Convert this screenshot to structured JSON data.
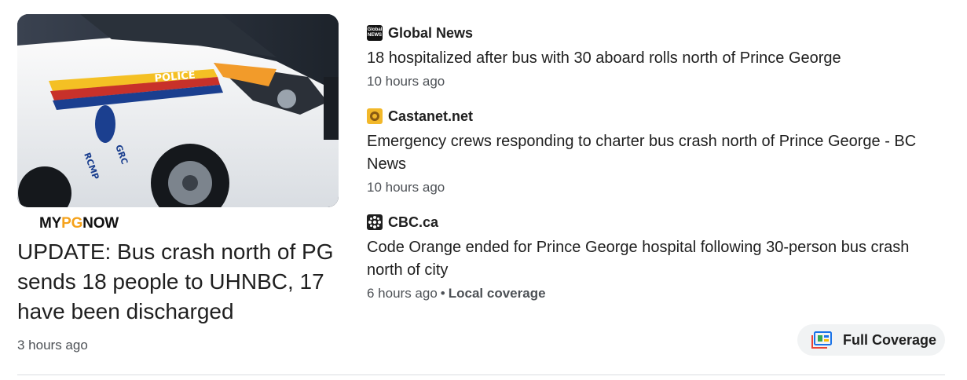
{
  "featured": {
    "source_logo_prefix": "MY",
    "source_logo_highlight": "PG",
    "source_logo_suffix": "NOW",
    "title": "UPDATE: Bus crash north of PG sends 18 people to UHNBC, 17 have been discharged",
    "time": "3 hours ago",
    "image_alt": "RCMP police vehicle"
  },
  "stories": [
    {
      "source": "Global News",
      "favicon": "global-news-icon",
      "title": "18 hospitalized after bus with 30 aboard rolls north of Prince George",
      "time": "10 hours ago"
    },
    {
      "source": "Castanet.net",
      "favicon": "castanet-icon",
      "title": "Emergency crews responding to charter bus crash north of Prince George - BC News",
      "time": "10 hours ago"
    },
    {
      "source": "CBC.ca",
      "favicon": "cbc-icon",
      "title": "Code Orange ended for Prince George hospital following 30-person bus crash north of city",
      "time": "6 hours ago",
      "tag": "Local coverage"
    }
  ],
  "full_coverage": {
    "label": "Full Coverage",
    "icon": "full-coverage-icon"
  },
  "colors": {
    "logo_highlight": "#f5a21b",
    "button_bg": "#f1f3f4",
    "muted_text": "#4d5156"
  }
}
